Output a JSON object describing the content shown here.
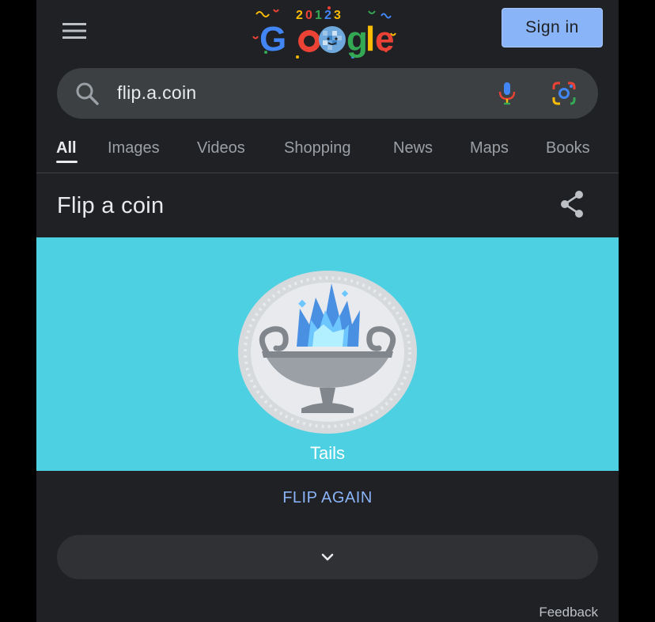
{
  "header": {
    "menu_icon": "hamburger-menu-icon",
    "logo_text": "Google",
    "logo_year": "2023",
    "sign_in_label": "Sign in"
  },
  "search": {
    "query": "flip.a.coin",
    "search_icon": "search-icon",
    "mic_icon": "microphone-icon",
    "lens_icon": "google-lens-icon"
  },
  "tabs": [
    {
      "label": "All",
      "active": true
    },
    {
      "label": "Images"
    },
    {
      "label": "Videos"
    },
    {
      "label": "Shopping"
    },
    {
      "label": "News"
    },
    {
      "label": "Maps"
    },
    {
      "label": "Books"
    }
  ],
  "card": {
    "title": "Flip a coin",
    "share_icon": "share-icon",
    "coin_side": "Tails",
    "flip_again_label": "FLIP AGAIN",
    "expand_icon": "chevron-down-icon",
    "feedback_label": "Feedback"
  },
  "colors": {
    "background": "#202124",
    "panel": "#4dd0e1",
    "sign_in": "#8ab4f8",
    "link": "#8ab4f8"
  }
}
